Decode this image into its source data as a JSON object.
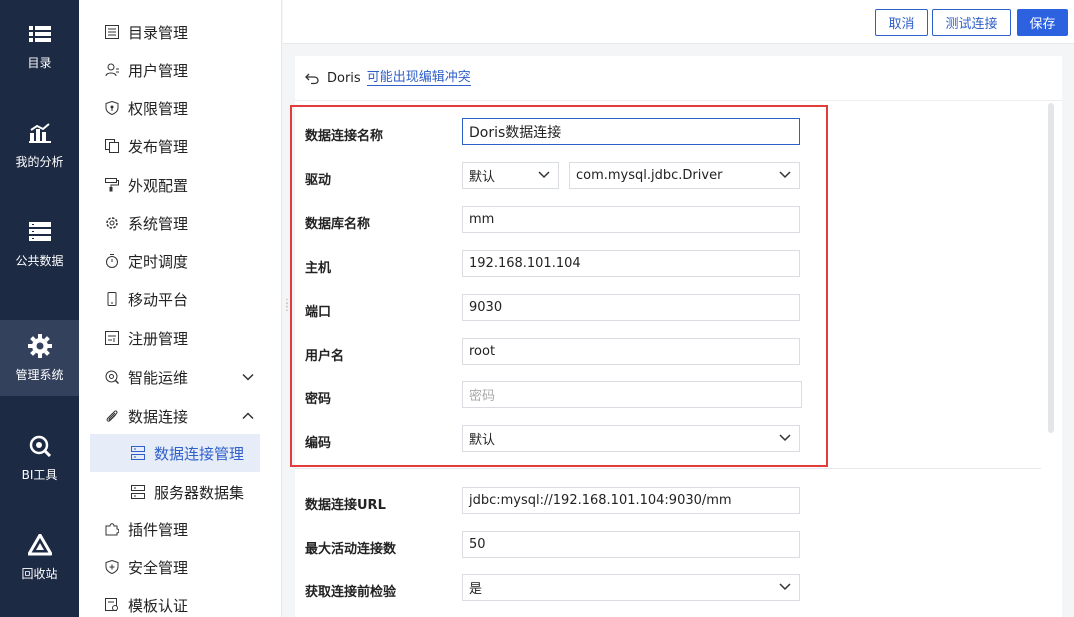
{
  "rail": [
    {
      "label": "目录",
      "icon": "list-icon"
    },
    {
      "label": "我的分析",
      "icon": "chart-icon"
    },
    {
      "label": "公共数据",
      "icon": "database-icon"
    },
    {
      "label": "管理系统",
      "icon": "gear-icon",
      "active": true
    },
    {
      "label": "BI工具",
      "icon": "tool-icon"
    },
    {
      "label": "回收站",
      "icon": "recycle-icon"
    }
  ],
  "menu": {
    "items": [
      {
        "label": "目录管理"
      },
      {
        "label": "用户管理"
      },
      {
        "label": "权限管理"
      },
      {
        "label": "发布管理"
      },
      {
        "label": "外观配置"
      },
      {
        "label": "系统管理"
      },
      {
        "label": "定时调度"
      },
      {
        "label": "移动平台"
      },
      {
        "label": "注册管理"
      },
      {
        "label": "智能运维"
      },
      {
        "label": "数据连接"
      },
      {
        "label": "插件管理"
      },
      {
        "label": "安全管理"
      },
      {
        "label": "模板认证"
      }
    ],
    "sub": [
      {
        "label": "数据连接管理"
      },
      {
        "label": "服务器数据集"
      }
    ]
  },
  "toolbar": {
    "cancel": "取消",
    "test": "测试连接",
    "save": "保存"
  },
  "header": {
    "name": "Doris",
    "warning": "可能出现编辑冲突"
  },
  "form": {
    "conn_name_label": "数据连接名称",
    "conn_name_value": "Doris数据连接",
    "driver_label": "驱动",
    "driver_mode": "默认",
    "driver_class": "com.mysql.jdbc.Driver",
    "db_name_label": "数据库名称",
    "db_name_value": "mm",
    "host_label": "主机",
    "host_value": "192.168.101.104",
    "port_label": "端口",
    "port_value": "9030",
    "user_label": "用户名",
    "user_value": "root",
    "password_label": "密码",
    "password_placeholder": "密码",
    "encoding_label": "编码",
    "encoding_value": "默认",
    "url_label": "数据连接URL",
    "url_value": "jdbc:mysql://192.168.101.104:9030/mm",
    "max_active_label": "最大活动连接数",
    "max_active_value": "50",
    "validate_label": "获取连接前检验",
    "validate_value": "是"
  },
  "colors": {
    "rail_bg": "#1d2a44",
    "accent": "#2c62e0",
    "highlight": "#e23c3c"
  }
}
